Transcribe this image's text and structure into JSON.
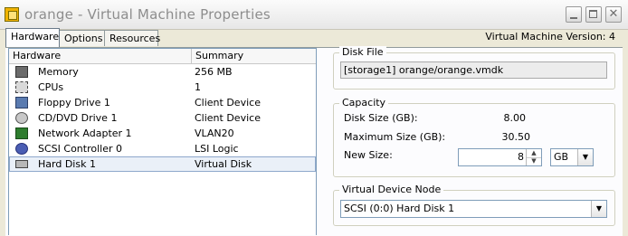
{
  "window": {
    "title": "orange - Virtual Machine Properties",
    "buttons": {
      "minimize_icon": "minimize-icon",
      "maximize_icon": "maximize-icon",
      "close_icon": "close-icon",
      "close_glyph": "✕"
    }
  },
  "tabs": [
    {
      "label": "Hardware",
      "active": true
    },
    {
      "label": "Options",
      "active": false
    },
    {
      "label": "Resources",
      "active": false
    }
  ],
  "version_text": "Virtual Machine Version: 4",
  "hardware_table": {
    "columns": [
      "Hardware",
      "Summary"
    ],
    "rows": [
      {
        "icon": "memory-icon",
        "name": "Memory",
        "summary": "256 MB"
      },
      {
        "icon": "cpu-icon",
        "name": "CPUs",
        "summary": "1"
      },
      {
        "icon": "floppy-icon",
        "name": "Floppy Drive 1",
        "summary": "Client Device"
      },
      {
        "icon": "cd-dvd-icon",
        "name": "CD/DVD Drive 1",
        "summary": "Client Device"
      },
      {
        "icon": "network-adapter-icon",
        "name": "Network Adapter 1",
        "summary": "VLAN20"
      },
      {
        "icon": "scsi-controller-icon",
        "name": "SCSI Controller 0",
        "summary": "LSI Logic"
      },
      {
        "icon": "hard-disk-icon",
        "name": "Hard Disk 1",
        "summary": "Virtual Disk",
        "selected": true
      }
    ]
  },
  "disk_file": {
    "legend": "Disk File",
    "value": "[storage1] orange/orange.vmdk"
  },
  "capacity": {
    "legend": "Capacity",
    "disk_size_label": "Disk Size (GB):",
    "disk_size_value": "8.00",
    "max_size_label": "Maximum Size (GB):",
    "max_size_value": "30.50",
    "new_size_label": "New Size:",
    "new_size_value": "8",
    "unit_value": "GB",
    "spin_up": "▲",
    "spin_down": "▼",
    "dropdown_glyph": "▼"
  },
  "virtual_device_node": {
    "legend": "Virtual Device Node",
    "value": "SCSI (0:0) Hard Disk 1",
    "dropdown_glyph": "▼"
  }
}
